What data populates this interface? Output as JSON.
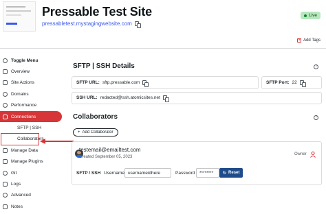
{
  "header": {
    "title": "Pressable Test Site",
    "url": "pressabletest.mystagingwebsite.com",
    "status": "Live",
    "add_tags": "Add Tags"
  },
  "sidebar": {
    "items": [
      {
        "label": "Toggle Menu"
      },
      {
        "label": "Overview"
      },
      {
        "label": "Site Actions"
      },
      {
        "label": "Domains"
      },
      {
        "label": "Performance"
      },
      {
        "label": "Connections"
      },
      {
        "label": "SFTP | SSH"
      },
      {
        "label": "Collaborators"
      },
      {
        "label": "Manage Data"
      },
      {
        "label": "Manage Plugins"
      },
      {
        "label": "Git"
      },
      {
        "label": "Logs"
      },
      {
        "label": "Advanced"
      },
      {
        "label": "Notes"
      }
    ]
  },
  "sftp": {
    "title": "SFTP | SSH Details",
    "sftp_url_label": "SFTP URL:",
    "sftp_url": "sftp.pressable.com",
    "sftp_port_label": "SFTP Port:",
    "sftp_port": "22",
    "ssh_url_label": "SSH URL:",
    "ssh_url": "redacted@ssh.atomicsites.net"
  },
  "collaborators": {
    "title": "Collaborators",
    "add_button": "Add Collaborator",
    "email": "testemail@emailtest.com",
    "created": "Created September 05, 2023",
    "role": "Owner",
    "sftp_label": "SFTP / SSH",
    "username_label": "Username",
    "username_value": "usernameidhere",
    "password_label": "Password",
    "password_value": "********",
    "reset_label": "Reset"
  },
  "colors": {
    "accent": "#d63638",
    "link": "#3858e9",
    "reset_button": "#1e4c8a",
    "live_badge": "#b8e6bf"
  }
}
